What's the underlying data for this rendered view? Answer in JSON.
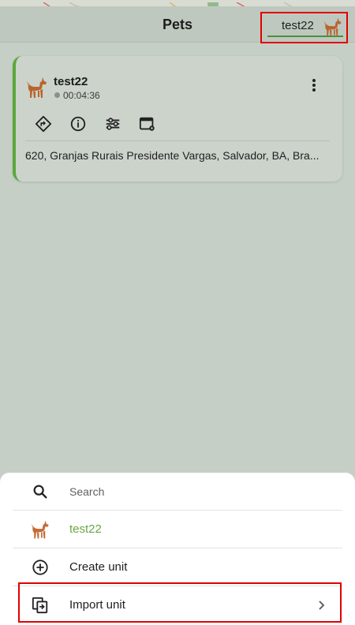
{
  "header": {
    "title": "Pets",
    "selected_unit": "test22"
  },
  "unit_card": {
    "name": "test22",
    "elapsed": "00:04:36",
    "address": "620, Granjas Rurais Presidente Vargas, Salvador, BA, Bra...",
    "status_color": "#8a918a",
    "accent_color": "#5aa83a",
    "actions": [
      "route-icon",
      "info-icon",
      "settings-sliders-icon",
      "calendar-gear-icon"
    ]
  },
  "action_sheet": {
    "search_placeholder": "Search",
    "unit_item": "test22",
    "create_label": "Create unit",
    "import_label": "Import unit"
  },
  "colors": {
    "accent_green": "#6aa844",
    "pet_icon": "#b9652f",
    "highlight_red": "#e00000"
  }
}
